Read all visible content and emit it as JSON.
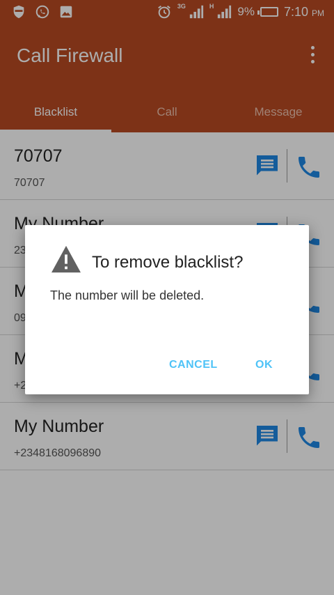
{
  "status_bar": {
    "network_3g": "3G",
    "network_h": "H",
    "battery": "9%",
    "time": "7:10",
    "ampm": "PM"
  },
  "app": {
    "title": "Call Firewall"
  },
  "tabs": [
    {
      "label": "Blacklist",
      "active": true
    },
    {
      "label": "Call",
      "active": false
    },
    {
      "label": "Message",
      "active": false
    }
  ],
  "blacklist": [
    {
      "name": "70707",
      "number": "70707"
    },
    {
      "name": "My Number",
      "number": "23"
    },
    {
      "name": "M",
      "number": "09"
    },
    {
      "name": "M",
      "number": "+2"
    },
    {
      "name": "My Number",
      "number": "+2348168096890"
    }
  ],
  "dialog": {
    "title": "To remove blacklist?",
    "message": "The number will be deleted.",
    "cancel_label": "CANCEL",
    "ok_label": "OK"
  },
  "colors": {
    "brand": "#b84a23",
    "action_blue": "#1e88e5",
    "dialog_button": "#4fc3f7"
  },
  "icons": {
    "message": "message-icon",
    "call": "phone-icon",
    "warning": "warning-icon"
  }
}
